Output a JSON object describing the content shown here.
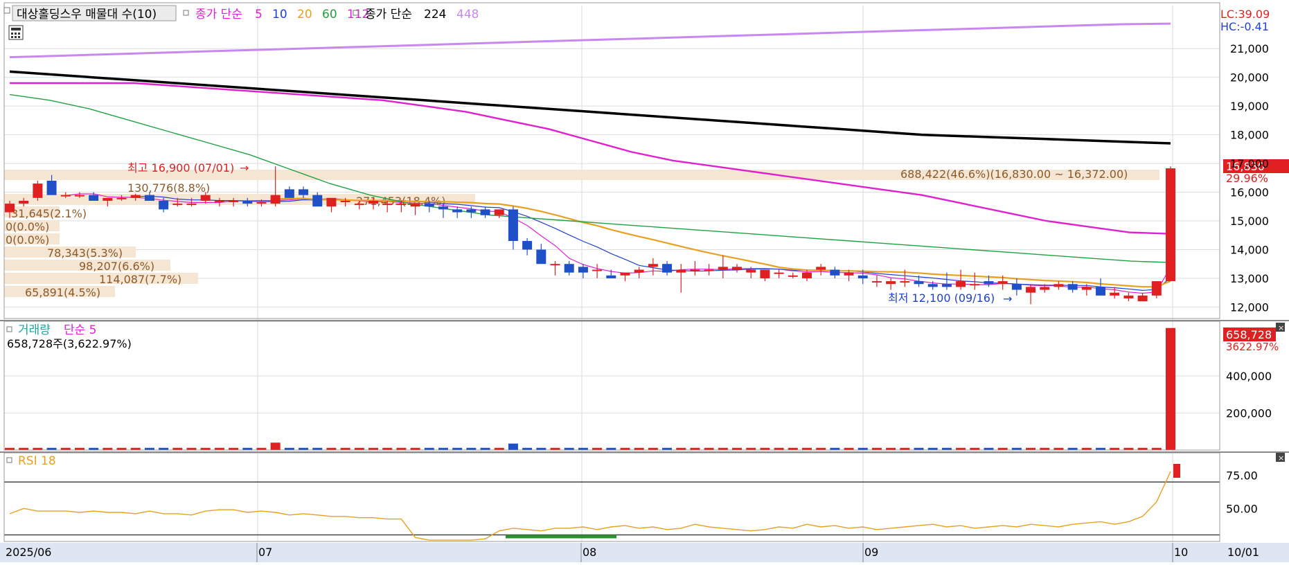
{
  "legend": {
    "price": {
      "title": "대상홀딩스우 매물대 수(10)",
      "ma_label": "종가 단순",
      "ma_periods": [
        {
          "label": "5",
          "color": "#e020d0"
        },
        {
          "label": "10",
          "color": "#2040d0"
        },
        {
          "label": "20",
          "color": "#e8a020"
        },
        {
          "label": "60",
          "color": "#20a040"
        },
        {
          "label": "112",
          "color": "#e020d0"
        }
      ],
      "ma2_label": "종가 단순",
      "ma2_periods": [
        {
          "label": "224",
          "color": "#000000"
        },
        {
          "label": "448",
          "color": "#c888f0"
        }
      ]
    },
    "volume": {
      "title": "거래량",
      "ma": "단순 5",
      "value_text": "658,728주(3,622.97%)"
    },
    "rsi": {
      "title": "RSI 18"
    }
  },
  "info": {
    "lc": "LC:39.09",
    "hc": "HC:-0.41"
  },
  "price_axis_ticks": [
    "21,000",
    "20,000",
    "19,000",
    "18,000",
    "17,000",
    "16,000",
    "15,000",
    "14,000",
    "13,000",
    "12,000"
  ],
  "volume_axis_ticks": [
    "400,000",
    "200,000"
  ],
  "rsi_axis_ticks": [
    "75.00",
    "50.00"
  ],
  "current": {
    "price": "16,830",
    "change": "29.96%",
    "volume": "658,728",
    "volume_change": "3622.97%"
  },
  "annotations": {
    "high": "최고 16,900 (07/01)",
    "low": "최저 12,100 (09/16)",
    "top_zone": "688,422(46.6%)(16,830.00 ~ 16,372.00)"
  },
  "volume_profile_labels": [
    "0(0.0%)",
    "0(0.0%)",
    "78,343(5.3%)",
    "98,207(6.6%)",
    "114,087(7.7%)",
    "65,891(4.5%)",
    "130,776(8.8%)",
    "31,645(2.1%)",
    "271,453(18.4%)"
  ],
  "x_axis_labels": [
    "2025/06",
    "07",
    "08",
    "09",
    "10",
    "10/01"
  ],
  "chart_data": {
    "type": "candlestick",
    "title": "대상홀딩스우 매물대 수(10)",
    "dates_label_positions": [
      "2025/06",
      "07",
      "08",
      "09",
      "10"
    ],
    "candles": [
      [
        15300,
        15700,
        15100,
        15600
      ],
      [
        15600,
        15800,
        15500,
        15700
      ],
      [
        15800,
        16400,
        15700,
        16300
      ],
      [
        16400,
        16600,
        15900,
        15900
      ],
      [
        15900,
        16000,
        15800,
        15900
      ],
      [
        15900,
        16000,
        15800,
        15900
      ],
      [
        15900,
        16000,
        15700,
        15700
      ],
      [
        15700,
        15800,
        15500,
        15800
      ],
      [
        15800,
        15900,
        15700,
        15800
      ],
      [
        15800,
        15950,
        15700,
        15900
      ],
      [
        15900,
        16000,
        15700,
        15700
      ],
      [
        15700,
        15800,
        15300,
        15400
      ],
      [
        15600,
        15800,
        15500,
        15600
      ],
      [
        15600,
        15800,
        15500,
        15600
      ],
      [
        15700,
        16000,
        15600,
        15900
      ],
      [
        15700,
        15800,
        15500,
        15700
      ],
      [
        15700,
        15800,
        15500,
        15700
      ],
      [
        15700,
        15800,
        15500,
        15600
      ],
      [
        15600,
        15750,
        15500,
        15650
      ],
      [
        15600,
        16900,
        15500,
        15900
      ],
      [
        16100,
        16200,
        15800,
        15800
      ],
      [
        16100,
        16200,
        15800,
        15900
      ],
      [
        15900,
        16000,
        15500,
        15500
      ],
      [
        15500,
        15700,
        15300,
        15800
      ],
      [
        15700,
        15800,
        15500,
        15700
      ],
      [
        15600,
        15700,
        15400,
        15600
      ],
      [
        15600,
        15800,
        15400,
        15700
      ],
      [
        15600,
        15700,
        15300,
        15600
      ],
      [
        15600,
        15700,
        15300,
        15600
      ],
      [
        15500,
        15600,
        15200,
        15600
      ],
      [
        15600,
        15700,
        15300,
        15500
      ],
      [
        15500,
        15600,
        15100,
        15400
      ],
      [
        15400,
        15500,
        15100,
        15300
      ],
      [
        15400,
        15500,
        15100,
        15300
      ],
      [
        15400,
        15500,
        15100,
        15200
      ],
      [
        15200,
        15400,
        15100,
        15400
      ],
      [
        15400,
        15500,
        14000,
        14300
      ],
      [
        14300,
        14400,
        13800,
        14000
      ],
      [
        14000,
        14200,
        13500,
        13500
      ],
      [
        13500,
        13600,
        13100,
        13500
      ],
      [
        13500,
        13600,
        13100,
        13200
      ],
      [
        13400,
        13500,
        13000,
        13200
      ],
      [
        13300,
        13500,
        13000,
        13300
      ],
      [
        13100,
        13300,
        13000,
        13000
      ],
      [
        13100,
        13200,
        12900,
        13200
      ],
      [
        13200,
        13400,
        13000,
        13300
      ],
      [
        13400,
        13700,
        13100,
        13500
      ],
      [
        13500,
        13600,
        13100,
        13200
      ],
      [
        13200,
        13500,
        12500,
        13300
      ],
      [
        13300,
        13600,
        13100,
        13300
      ],
      [
        13300,
        13500,
        13100,
        13300
      ],
      [
        13300,
        13800,
        13000,
        13400
      ],
      [
        13300,
        13500,
        13200,
        13400
      ],
      [
        13200,
        13400,
        13000,
        13300
      ],
      [
        13000,
        13300,
        12900,
        13300
      ],
      [
        13200,
        13300,
        13000,
        13200
      ],
      [
        13100,
        13200,
        13000,
        13100
      ],
      [
        13000,
        13300,
        12900,
        13200
      ],
      [
        13300,
        13500,
        13100,
        13400
      ],
      [
        13300,
        13400,
        13000,
        13100
      ],
      [
        13100,
        13300,
        12900,
        13200
      ],
      [
        13100,
        13300,
        12800,
        13000
      ],
      [
        12900,
        13100,
        12700,
        12900
      ],
      [
        12800,
        13000,
        12600,
        12900
      ],
      [
        12900,
        13300,
        12700,
        12900
      ],
      [
        12900,
        13100,
        12700,
        12800
      ],
      [
        12800,
        12900,
        12600,
        12700
      ],
      [
        12800,
        13200,
        12600,
        12700
      ],
      [
        12700,
        13300,
        12600,
        12900
      ],
      [
        12800,
        13200,
        12600,
        12800
      ],
      [
        12900,
        13100,
        12700,
        12800
      ],
      [
        12800,
        13100,
        12600,
        12900
      ],
      [
        12800,
        13000,
        12400,
        12600
      ],
      [
        12500,
        12800,
        12100,
        12700
      ],
      [
        12600,
        12800,
        12500,
        12700
      ],
      [
        12700,
        12900,
        12600,
        12800
      ],
      [
        12800,
        12900,
        12500,
        12600
      ],
      [
        12600,
        12800,
        12400,
        12700
      ],
      [
        12700,
        13000,
        12500,
        12400
      ],
      [
        12400,
        12700,
        12300,
        12500
      ],
      [
        12300,
        12500,
        12200,
        12400
      ],
      [
        12200,
        12500,
        12200,
        12400
      ],
      [
        12400,
        12700,
        12300,
        12900
      ],
      [
        12900,
        16900,
        12900,
        16830
      ]
    ],
    "ma_series": [
      {
        "name": "224",
        "values": [
          20200,
          20100,
          20000,
          19900,
          19800,
          19700,
          19600,
          19500,
          19400,
          19300,
          19200,
          19100,
          19000,
          18900,
          18800,
          18700,
          18600,
          18500,
          18400,
          18300,
          18200,
          18100,
          18000,
          17950,
          17900,
          17850,
          17800,
          17750,
          17700
        ]
      },
      {
        "name": "448",
        "values": [
          20700,
          20750,
          20800,
          20850,
          20900,
          20950,
          21000,
          21050,
          21100,
          21150,
          21200,
          21250,
          21300,
          21350,
          21400,
          21450,
          21500,
          21550,
          21600,
          21650,
          21700,
          21750,
          21800,
          21850,
          21870
        ]
      }
    ],
    "ylim": [
      11600,
      22500
    ],
    "volume": {
      "last": 658728,
      "ylim": [
        0,
        680000
      ]
    },
    "rsi": {
      "last": 78,
      "ylim": [
        25,
        90
      ],
      "ref_lines": [
        70,
        30
      ]
    }
  }
}
